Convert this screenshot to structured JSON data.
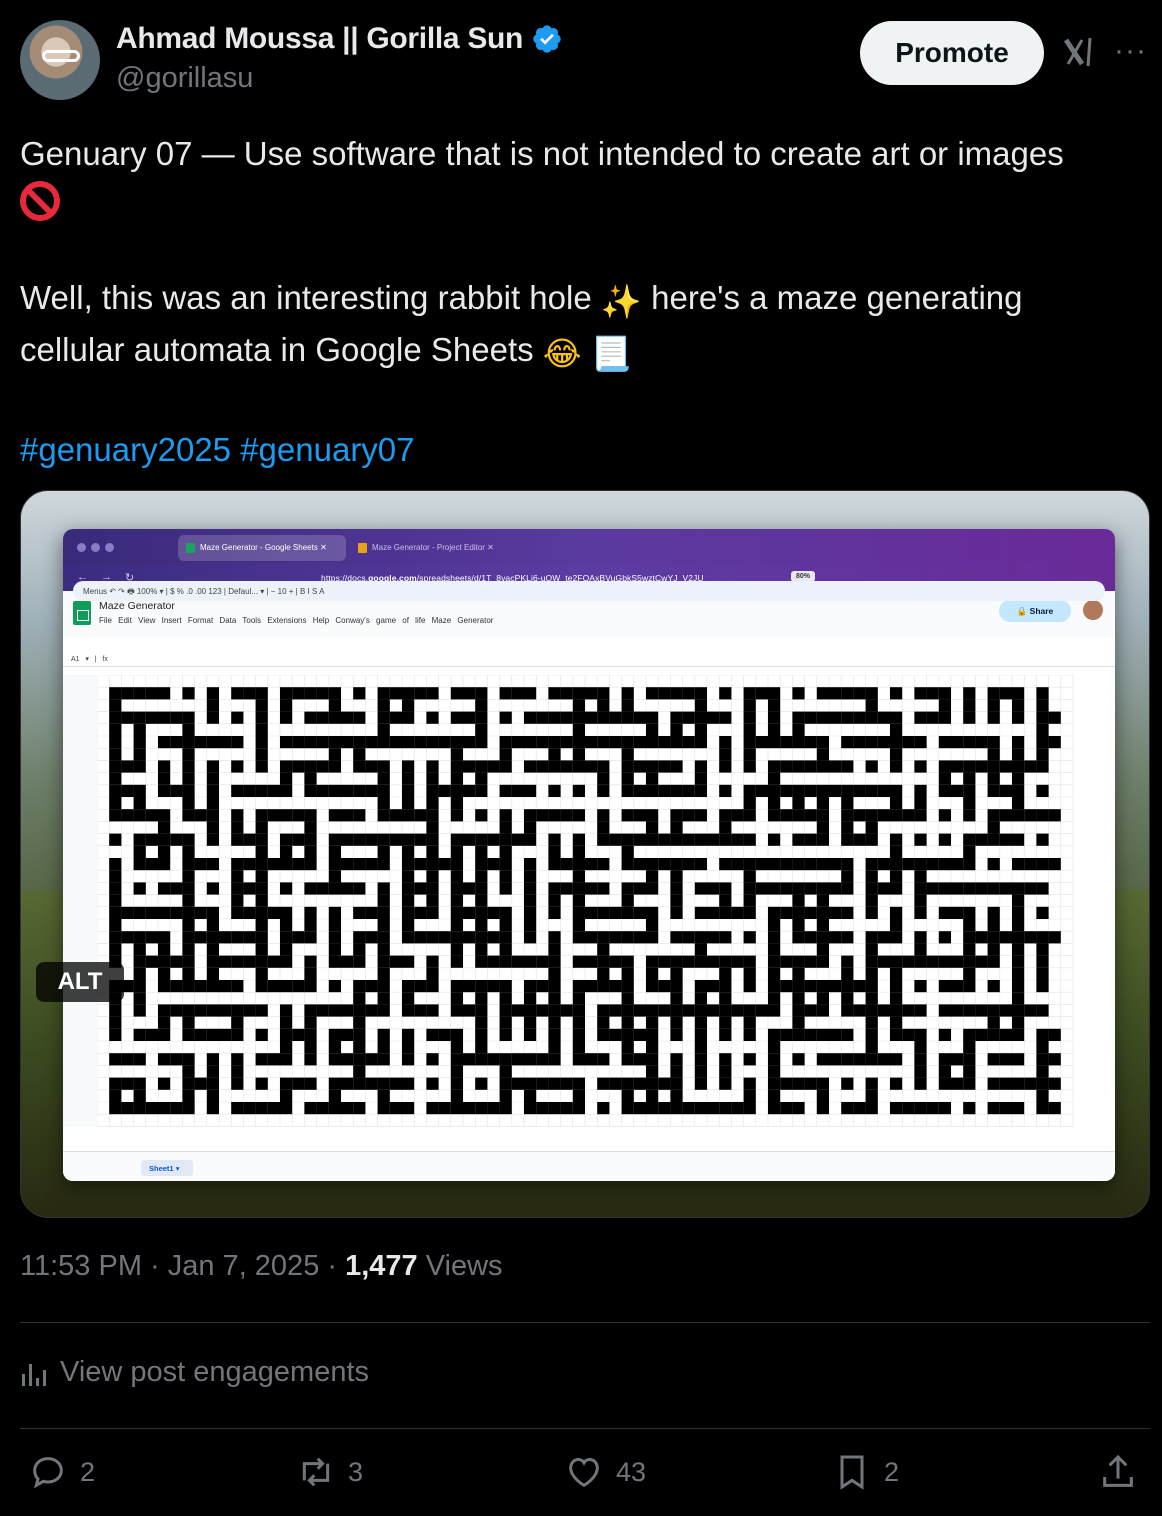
{
  "author": {
    "name": "Ahmad Moussa || Gorilla Sun",
    "handle": "@gorillasu"
  },
  "header": {
    "promote_label": "Promote"
  },
  "tweet": {
    "line1": "Genuary 07 — Use software that is not intended to create art or images",
    "line2a": "Well, this was an interesting rabbit hole",
    "line2b": "here's a maze generating",
    "line3": "cellular automata in Google Sheets",
    "hashtag1": "#genuary2025",
    "hashtag2": "#genuary07"
  },
  "media": {
    "alt_label": "ALT",
    "browser": {
      "tab_active": "Maze Generator - Google Sheets",
      "tab_inactive": "Maze Generator - Project Editor",
      "url_prefix": "https://docs.",
      "url_domain": "google.com",
      "url_path": "/spreadsheets/d/1T_8vacPKLj6-uQW_te2FQAxBVuGbkS5wztCwYJ_V2JU",
      "zoom": "80%"
    },
    "sheets": {
      "title": "Maze Generator",
      "menu": [
        "File",
        "Edit",
        "View",
        "Insert",
        "Format",
        "Data",
        "Tools",
        "Extensions",
        "Help",
        "Conway's game of life",
        "Maze Generator"
      ],
      "share_label": "Share",
      "toolbar_text": "Menus   ↶  ↷  🖶  100% ▾  |  $  %  .0  .00  123  |  Defaul... ▾  |  −  10  +  |  B  I  S  A",
      "cell_ref": "A1",
      "fx": "fx",
      "sheet_tab": "Sheet1"
    }
  },
  "meta": {
    "time": "11:53 PM · Jan 7, 2025 · ",
    "views_count": "1,477",
    "views_label": " Views"
  },
  "engagements_label": "View post engagements",
  "actions": {
    "replies": "2",
    "reposts": "3",
    "likes": "43",
    "bookmarks": "2"
  }
}
